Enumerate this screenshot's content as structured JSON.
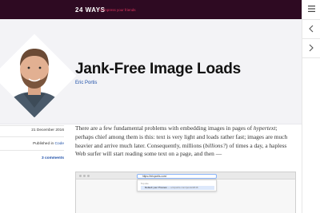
{
  "header": {
    "logo": "24 WAYS",
    "tagline": "to impress your friends"
  },
  "article": {
    "title": "Jank-Free Image Loads",
    "author": "Eric Portis",
    "date": "21 December 2016",
    "published_prefix": "Published in ",
    "published_category": "Code",
    "comments": "3 comments",
    "paragraph": {
      "p1": "There are a few fundamental problems with embedding images in pages of ",
      "hypertext": "hypertext",
      "p2": "; perhaps chief among them is this: text is very light and loads rather fast; images are much heavier and arrive much later. Consequently, millions (",
      "billions": "billions?",
      "p3": ") of times a day, a hapless Web surfer will start reading some text on a page, and then —"
    },
    "screenshot": {
      "url": "https://ericportis.com/",
      "suggest_head": "Top site",
      "suggest_title": "Default your Preview",
      "suggest_url": " — ericportis.com/posts/2016"
    }
  },
  "sidenav": {
    "menu_icon": "menu-icon",
    "prev_icon": "chevron-left-icon",
    "next_icon": "chevron-right-icon"
  }
}
